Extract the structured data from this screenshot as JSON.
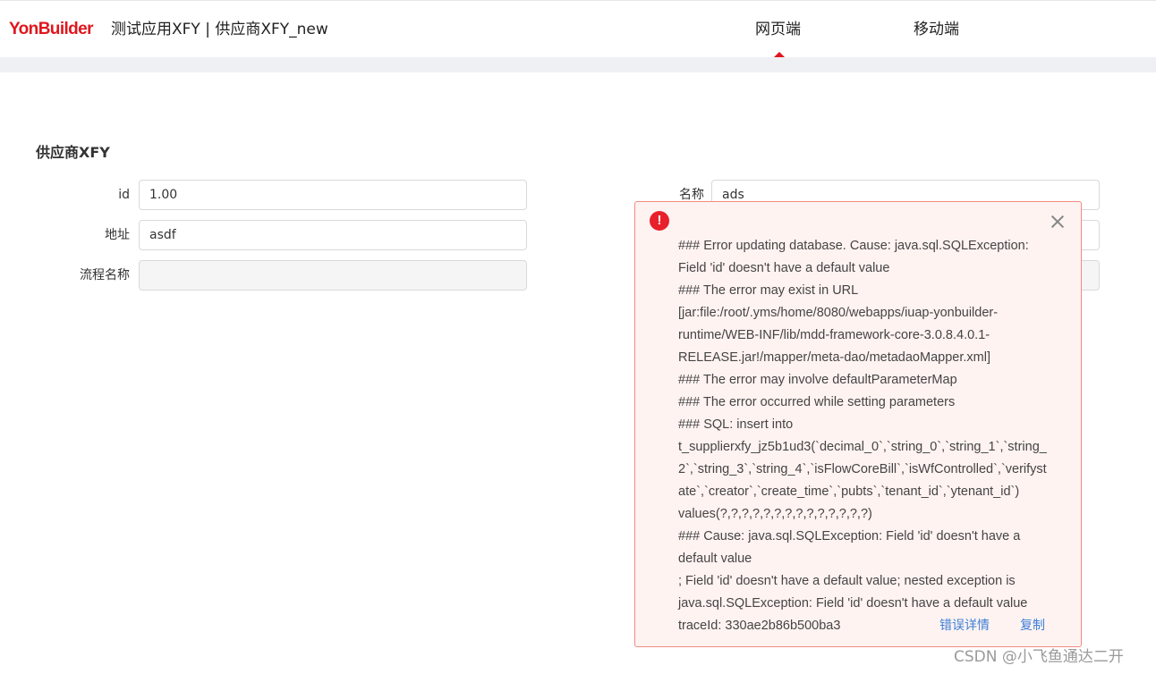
{
  "header": {
    "logo_part1": "Yon",
    "logo_part2": "Builder",
    "app_title": "测试应用XFY | 供应商XFY_new",
    "tabs": [
      {
        "label": "网页端",
        "active": true
      },
      {
        "label": "移动端",
        "active": false
      }
    ]
  },
  "form": {
    "title": "供应商XFY",
    "fields": [
      {
        "label": "id",
        "value": "1.00"
      },
      {
        "label": "地址",
        "value": "asdf"
      },
      {
        "label": "流程名称",
        "value": ""
      },
      {
        "label": "名称",
        "value": "ads"
      }
    ]
  },
  "error": {
    "lines": [
      "### Error updating database.  Cause: java.sql.SQLException:",
      "Field 'id' doesn't have a default value",
      "### The error may exist in URL",
      "[jar:file:/root/.yms/home/8080/webapps/iuap-yonbuilder-",
      "runtime/WEB-INF/lib/mdd-framework-core-3.0.8.4.0.1-",
      "RELEASE.jar!/mapper/meta-dao/metadaoMapper.xml]",
      "### The error may involve defaultParameterMap",
      "### The error occurred while setting parameters",
      "### SQL: insert into",
      "t_supplierxfy_jz5b1ud3(`decimal_0`,`string_0`,`string_1`,`string_",
      "2`,`string_3`,`string_4`,`isFlowCoreBill`,`isWfControlled`,`verifyst",
      "ate`,`creator`,`create_time`,`pubts`,`tenant_id`,`ytenant_id`)",
      "values(?,?,?,?,?,?,?,?,?,?,?,?,?,?)",
      "### Cause: java.sql.SQLException: Field 'id' doesn't have a",
      "default value",
      "; Field 'id' doesn't have a default value; nested exception is",
      "java.sql.SQLException: Field 'id' doesn't have a default value"
    ],
    "trace_id": "traceId: 330ae2b86b500ba3",
    "details_label": "错误详情",
    "copy_label": "复制"
  },
  "watermark": "CSDN @小飞鱼通达二开",
  "colors": {
    "brand_red": "#e0161e",
    "error_bg": "#fff3f1",
    "error_border": "#f28b82",
    "link_blue": "#3b7fd8"
  }
}
